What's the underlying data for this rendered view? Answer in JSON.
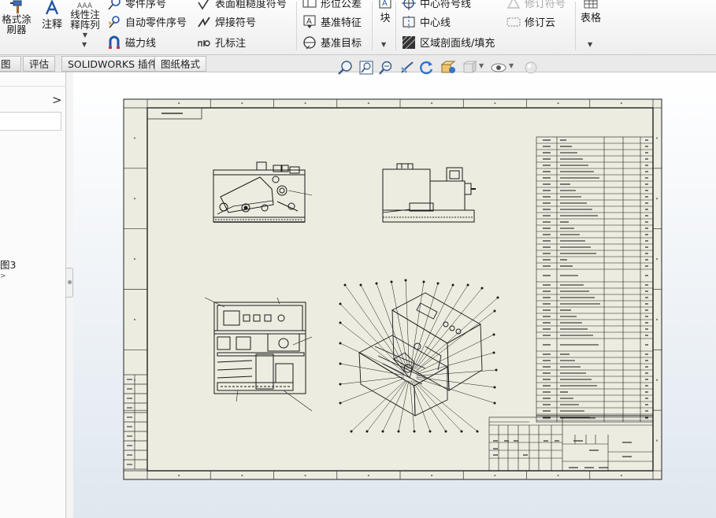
{
  "ribbon": {
    "format_painter": "格式涂\n刷器",
    "format_painter_l1": "格式涂",
    "format_painter_l2": "刷器",
    "annotation": "注释",
    "linear_pattern_l1": "线性注",
    "linear_pattern_l2": "释阵列",
    "balloon": "零件序号",
    "auto_balloon": "自动零件序号",
    "magnetic_line": "磁力线",
    "surface_finish": "表面粗糙度符号",
    "weld_symbol": "焊接符号",
    "hole_callout": "孔标注",
    "geometric_tolerance": "形位公差",
    "datum_feature": "基准特征",
    "datum_target": "基准目标",
    "block": "块",
    "centermark": "中心符号线",
    "centerline": "中心线",
    "area_hatch": "区域剖面线/填充",
    "revision_symbol": "修订符号",
    "revision_cloud": "修订云",
    "table": "表格"
  },
  "tabs": [
    {
      "label": "图"
    },
    {
      "label": "评估"
    },
    {
      "label": "SOLIDWORKS 插件"
    },
    {
      "label": "图纸格式"
    }
  ],
  "feature_tree": {
    "sheet_item": "图3",
    "expand_arrow": ">"
  },
  "colors": {
    "sheet_bg": "#ecece0",
    "line": "#1a1a1a",
    "viewport_top": "#ffffff",
    "viewport_bottom": "#dfe7ef"
  }
}
